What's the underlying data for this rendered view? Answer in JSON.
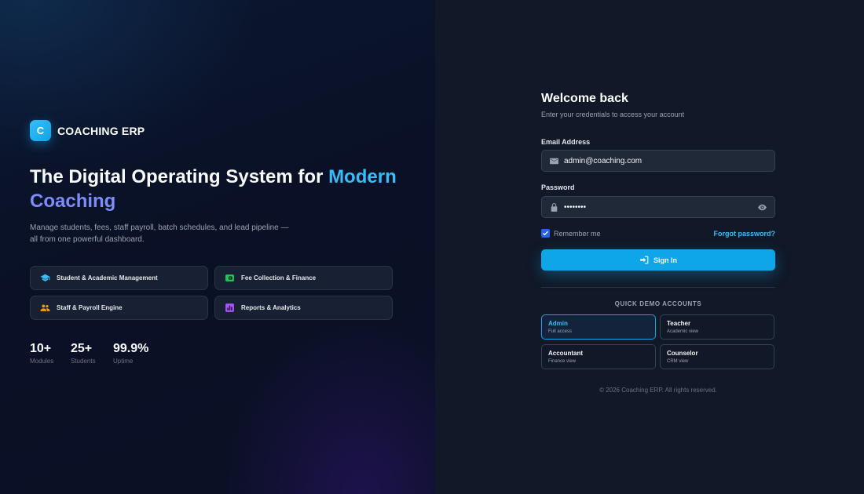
{
  "brand": {
    "logo_letter": "C",
    "name": "COACHING ERP"
  },
  "hero": {
    "headline_prefix": "The Digital Operating System for ",
    "headline_accent_1": "Modern",
    "headline_accent_2": "Coaching",
    "description": "Manage students, fees, staff payroll, batch schedules, and lead pipeline — all from one powerful dashboard."
  },
  "features": [
    {
      "label": "Student & Academic Management",
      "icon": "graduation-cap-icon",
      "color": "#38bdf8"
    },
    {
      "label": "Fee Collection & Finance",
      "icon": "wallet-icon",
      "color": "#22c55e"
    },
    {
      "label": "Staff & Payroll Engine",
      "icon": "people-icon",
      "color": "#f59e0b"
    },
    {
      "label": "Reports & Analytics",
      "icon": "bar-chart-icon",
      "color": "#a855f7"
    }
  ],
  "stats": [
    {
      "value": "10+",
      "label": "Modules"
    },
    {
      "value": "25+",
      "label": "Students"
    },
    {
      "value": "99.9%",
      "label": "Uptime"
    }
  ],
  "form": {
    "title": "Welcome back",
    "subtitle": "Enter your credentials to access your account",
    "email_label": "Email Address",
    "email_value": "admin@coaching.com",
    "password_label": "Password",
    "password_value": "••••••••",
    "remember_label": "Remember me",
    "remember_checked": true,
    "forgot_label": "Forgot password?",
    "signin_label": "Sign In"
  },
  "demo": {
    "heading": "QUICK DEMO ACCOUNTS",
    "accounts": [
      {
        "name": "Admin",
        "desc": "Full access",
        "active": true
      },
      {
        "name": "Teacher",
        "desc": "Academic view",
        "active": false
      },
      {
        "name": "Accountant",
        "desc": "Finance view",
        "active": false
      },
      {
        "name": "Counselor",
        "desc": "CRM view",
        "active": false
      }
    ]
  },
  "footer": "© 2026 Coaching ERP. All rights reserved.",
  "colors": {
    "accent": "#0ea5e9",
    "accent_light": "#38bdf8",
    "gradient_end": "#818cf8",
    "background": "#111827"
  }
}
